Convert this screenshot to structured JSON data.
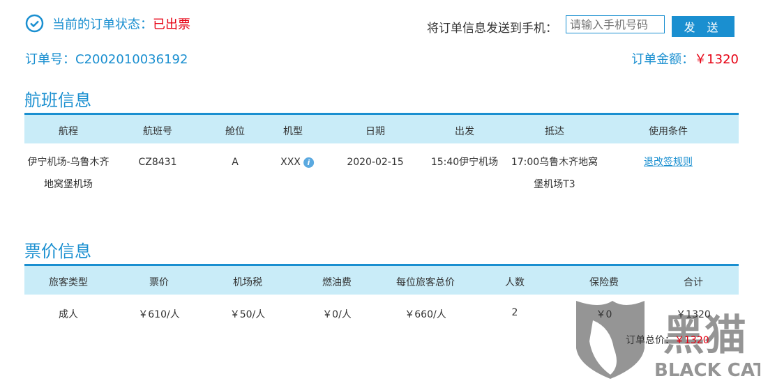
{
  "status": {
    "label": "当前的订单状态：",
    "value": "已出票"
  },
  "order": {
    "label": "订单号：",
    "number": "C2002010036192",
    "amount_label": "订单金额：",
    "amount": "￥1320"
  },
  "send": {
    "label": "将订单信息发送到手机：",
    "placeholder": "请输入手机号码",
    "button": "发 送"
  },
  "flight": {
    "title": "航班信息",
    "headers": [
      "航程",
      "航班号",
      "舱位",
      "机型",
      "日期",
      "出发",
      "抵达",
      "使用条件"
    ],
    "row": {
      "route": [
        "伊宁机场-乌鲁木齐",
        "地窝堡机场"
      ],
      "flight_no": "CZ8431",
      "cabin": "A",
      "aircraft": "XXX",
      "date": "2020-02-15",
      "depart": "15:40伊宁机场",
      "arrive": [
        "17:00乌鲁木齐地窝",
        "堡机场T3"
      ],
      "conditions": "退改签规则"
    }
  },
  "price": {
    "title": "票价信息",
    "headers": [
      "旅客类型",
      "票价",
      "机场税",
      "燃油费",
      "每位旅客总价",
      "人数",
      "保险费",
      "合计"
    ],
    "row": [
      "成人",
      "￥610/人",
      "￥50/人",
      "￥0/人",
      "￥660/人",
      "2",
      "￥0",
      "￥1320"
    ],
    "total_label": "订单总价：",
    "total": "￥1320"
  },
  "watermark": {
    "cn": "黑猫",
    "en": "BLACK CAT"
  }
}
